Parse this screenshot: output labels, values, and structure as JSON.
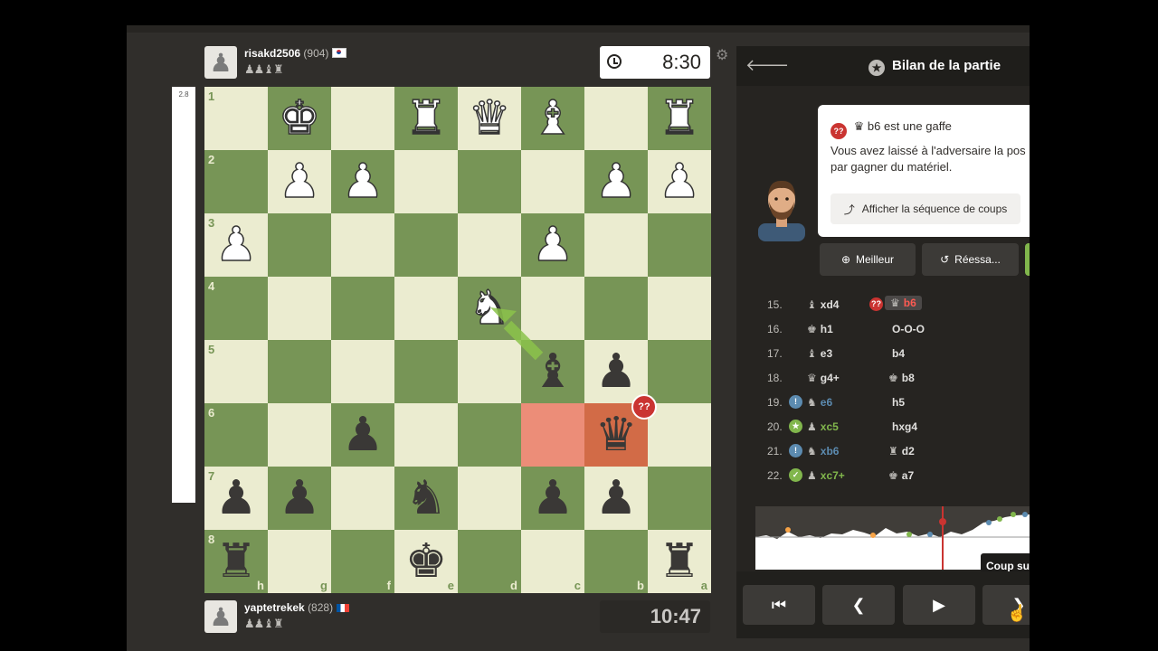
{
  "top_player": {
    "name": "risakd2506",
    "rating": "(904)",
    "captured": "♟♟♝♜"
  },
  "bottom_player": {
    "name": "yaptetrekek",
    "rating": "(828)",
    "captured": "♟♟♝♜"
  },
  "clocks": {
    "top": "8:30",
    "bottom": "10:47"
  },
  "eval": {
    "value": "2.8"
  },
  "board": {
    "ranks": [
      "1",
      "2",
      "3",
      "4",
      "5",
      "6",
      "7",
      "8"
    ],
    "files": [
      "h",
      "g",
      "f",
      "e",
      "d",
      "c",
      "b",
      "a"
    ],
    "pieces": [
      [
        "",
        "♚",
        "",
        "♜",
        "♛",
        "♝",
        "",
        "♜"
      ],
      [
        "",
        "♟",
        "♟",
        "",
        "",
        "",
        "♟",
        "♟"
      ],
      [
        "♟",
        "",
        "",
        "",
        "",
        "♟",
        "",
        ""
      ],
      [
        "",
        "",
        "",
        "",
        "♞",
        "",
        "",
        ""
      ],
      [
        "",
        "",
        "",
        "",
        "",
        "♝",
        "♟",
        ""
      ],
      [
        "",
        "",
        "♟",
        "",
        "",
        "",
        "♛",
        ""
      ],
      [
        "♟",
        "♟",
        "",
        "♞",
        "",
        "♟",
        "♟",
        ""
      ],
      [
        "♜",
        "",
        "",
        "♚",
        "",
        "",
        "",
        "♜"
      ]
    ],
    "colors": [
      [
        "",
        "w",
        "",
        "w",
        "w",
        "w",
        "",
        "w"
      ],
      [
        "",
        "w",
        "w",
        "",
        "",
        "",
        "w",
        "w"
      ],
      [
        "w",
        "",
        "",
        "",
        "",
        "w",
        "",
        ""
      ],
      [
        "",
        "",
        "",
        "",
        "w",
        "",
        "",
        ""
      ],
      [
        "",
        "",
        "",
        "",
        "",
        "b",
        "b",
        ""
      ],
      [
        "",
        "",
        "b",
        "",
        "",
        "",
        "b",
        ""
      ],
      [
        "b",
        "b",
        "",
        "b",
        "",
        "b",
        "b",
        ""
      ],
      [
        "b",
        "",
        "",
        "b",
        "",
        "",
        "",
        "b"
      ]
    ],
    "blunder_badge": "??"
  },
  "panel": {
    "title": "Bilan de la partie",
    "bubble_header": "b6 est une gaffe",
    "bubble_badge": "??",
    "bubble_desc_1": "Vous avez laissé à l'adversaire la pos",
    "bubble_desc_2": "par gagner du matériel.",
    "show_sequence": "Afficher la séquence de coups",
    "best_button": "Meilleur",
    "retry_button": "Réessa...",
    "tooltip": "Coup sui"
  },
  "moves": [
    {
      "no": "15.",
      "wpic": "♝",
      "white": "xd4",
      "wbadge": "",
      "wcolor": "",
      "bpic": "♛",
      "black": "b6",
      "bbadge": "??",
      "bcolor": "#ca3431",
      "hl": true
    },
    {
      "no": "16.",
      "wpic": "♚",
      "white": "h1",
      "wbadge": "",
      "wcolor": "",
      "bpic": "",
      "black": "O-O-O",
      "bbadge": "",
      "bcolor": "",
      "hl": false
    },
    {
      "no": "17.",
      "wpic": "♝",
      "white": "e3",
      "wbadge": "",
      "wcolor": "",
      "bpic": "",
      "black": "b4",
      "bbadge": "",
      "bcolor": "",
      "hl": false
    },
    {
      "no": "18.",
      "wpic": "♛",
      "white": "g4+",
      "wbadge": "",
      "wcolor": "",
      "bpic": "♚",
      "black": "b8",
      "bbadge": "",
      "bcolor": "",
      "hl": false
    },
    {
      "no": "19.",
      "wpic": "♞",
      "white": "e6",
      "wbadge": "!",
      "wcolor": "#5c8bb0",
      "bpic": "",
      "black": "h5",
      "bbadge": "",
      "bcolor": "",
      "hl": false
    },
    {
      "no": "20.",
      "wpic": "♟",
      "white": "xc5",
      "wbadge": "★",
      "wcolor": "#81b64c",
      "bpic": "",
      "black": "hxg4",
      "bbadge": "",
      "bcolor": "",
      "hl": false
    },
    {
      "no": "21.",
      "wpic": "♞",
      "white": "xb6",
      "wbadge": "!",
      "wcolor": "#5c8bb0",
      "bpic": "♜",
      "black": "d2",
      "bbadge": "",
      "bcolor": "",
      "hl": false
    },
    {
      "no": "22.",
      "wpic": "♟",
      "white": "xc7+",
      "wbadge": "✓",
      "wcolor": "#81b64c",
      "bpic": "♚",
      "black": "a7",
      "bbadge": "",
      "bcolor": "",
      "hl": false
    }
  ],
  "colors": {
    "accent": "#81b64c",
    "blunder": "#ca3431",
    "light_square": "#ebecd0",
    "dark_square": "#779556"
  }
}
